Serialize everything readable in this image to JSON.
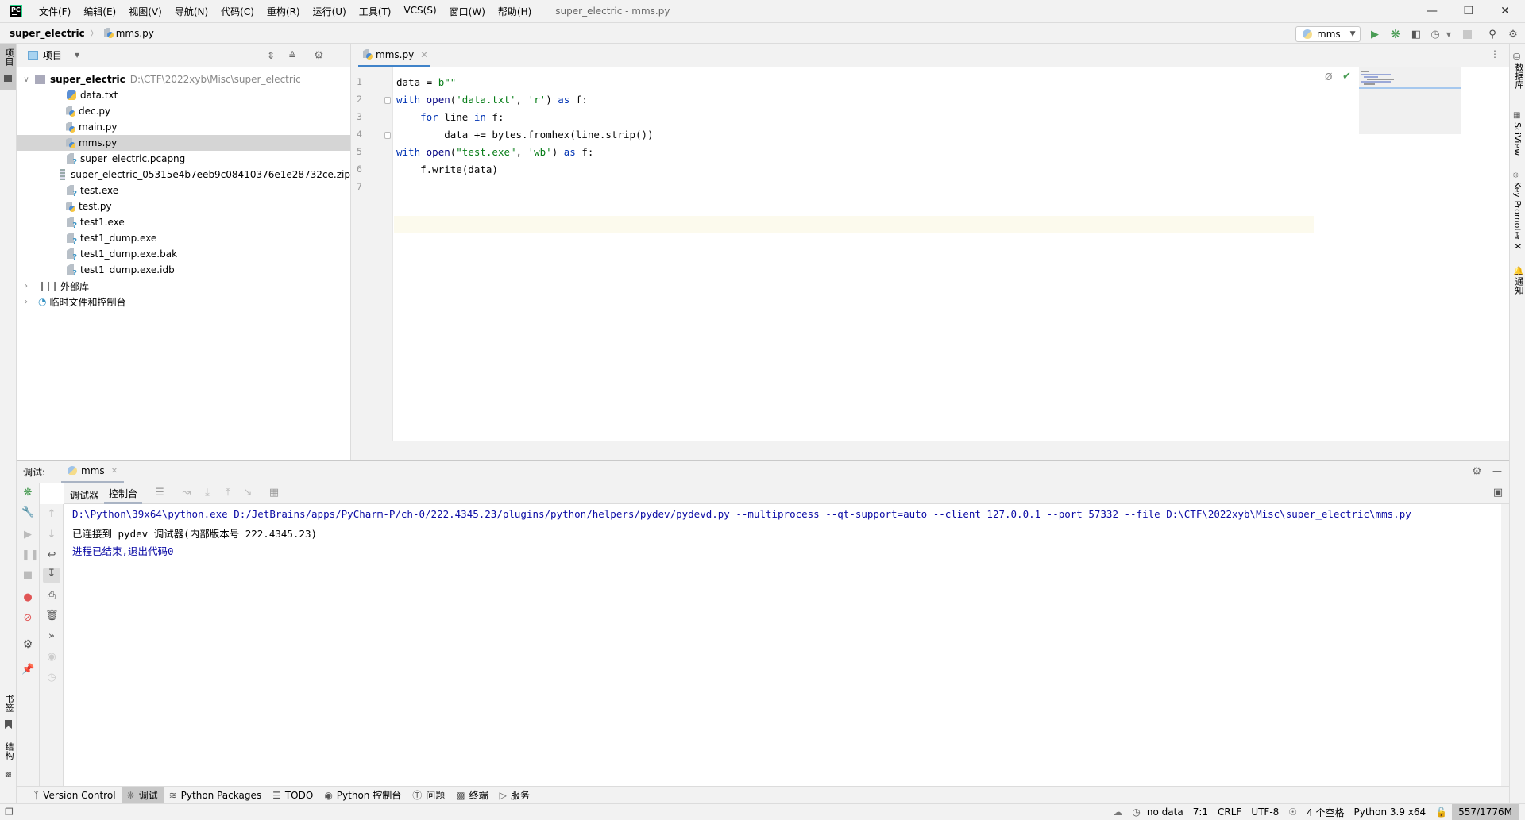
{
  "window": {
    "title": "super_electric - mms.py",
    "app_logo": "PC"
  },
  "menu": [
    "文件(F)",
    "编辑(E)",
    "视图(V)",
    "导航(N)",
    "代码(C)",
    "重构(R)",
    "运行(U)",
    "工具(T)",
    "VCS(S)",
    "窗口(W)",
    "帮助(H)"
  ],
  "breadcrumb": {
    "project": "super_electric",
    "file": "mms.py"
  },
  "run_config": {
    "name": "mms"
  },
  "left_strip": {
    "project_tab": "项目",
    "bookmarks_tab": "书签",
    "structure_tab": "结构"
  },
  "right_strip": {
    "database_tab": "数据库",
    "sciview_tab": "SciView",
    "keypromoter_tab": "Key Promoter X",
    "notifications_tab": "通知"
  },
  "project_panel": {
    "view_label": "项目",
    "root": {
      "name": "super_electric",
      "path": "D:\\CTF\\2022xyb\\Misc\\super_electric"
    },
    "files": [
      {
        "name": "data.txt",
        "type": "txt"
      },
      {
        "name": "dec.py",
        "type": "py"
      },
      {
        "name": "main.py",
        "type": "py"
      },
      {
        "name": "mms.py",
        "type": "py",
        "selected": true
      },
      {
        "name": "super_electric.pcapng",
        "type": "unknown"
      },
      {
        "name": "super_electric_05315e4b7eeb9c08410376e1e28732ce.zip",
        "type": "zip"
      },
      {
        "name": "test.exe",
        "type": "unknown"
      },
      {
        "name": "test.py",
        "type": "py"
      },
      {
        "name": "test1.exe",
        "type": "unknown"
      },
      {
        "name": "test1_dump.exe",
        "type": "unknown"
      },
      {
        "name": "test1_dump.exe.bak",
        "type": "unknown"
      },
      {
        "name": "test1_dump.exe.idb",
        "type": "unknown"
      }
    ],
    "external_libraries": "外部库",
    "scratches": "临时文件和控制台"
  },
  "editor": {
    "tab": "mms.py",
    "line_numbers": [
      "1",
      "2",
      "3",
      "4",
      "5",
      "6",
      "7"
    ],
    "current_line": 7,
    "lines": [
      "data = b\"\"",
      "with open('data.txt', 'r') as f:",
      "    for line in f:",
      "        data += bytes.fromhex(line.strip())",
      "with open(\"test.exe\", 'wb') as f:",
      "    f.write(data)",
      ""
    ]
  },
  "debug": {
    "label": "调试:",
    "session_tab": "mms",
    "subtabs": {
      "debugger": "调试器",
      "console": "控制台"
    },
    "console_lines": [
      {
        "text": "D:\\Python\\39x64\\python.exe D:/JetBrains/apps/PyCharm-P/ch-0/222.4345.23/plugins/python/helpers/pydev/pydevd.py --multiprocess --qt-support=auto --client 127.0.0.1 --port 57332 --file D:\\CTF\\2022xyb\\Misc\\super_electric\\mms.py",
        "style": "system"
      },
      {
        "text": "已连接到 pydev 调试器(内部版本号 222.4345.23)",
        "style": "plain"
      },
      {
        "text": "进程已结束,退出代码0",
        "style": "system"
      }
    ]
  },
  "tool_tabs": [
    {
      "label": "Version Control",
      "icon": "vcs-icon"
    },
    {
      "label": "调试",
      "icon": "bug-icon",
      "active": true
    },
    {
      "label": "Python Packages",
      "icon": "packages-icon"
    },
    {
      "label": "TODO",
      "icon": "list-icon"
    },
    {
      "label": "Python 控制台",
      "icon": "python-icon"
    },
    {
      "label": "问题",
      "icon": "problems-icon"
    },
    {
      "label": "终端",
      "icon": "terminal-icon"
    },
    {
      "label": "服务",
      "icon": "services-icon"
    }
  ],
  "status": {
    "no_data": "no data",
    "position": "7:1",
    "line_sep": "CRLF",
    "encoding": "UTF-8",
    "indent": "4 个空格",
    "interpreter": "Python 3.9 x64",
    "memory": "557/1776M"
  },
  "colors": {
    "accent": "#4083c9",
    "run_green": "#499c54",
    "console_blue": "#0b0ba5",
    "current_line": "#fcfaed"
  }
}
